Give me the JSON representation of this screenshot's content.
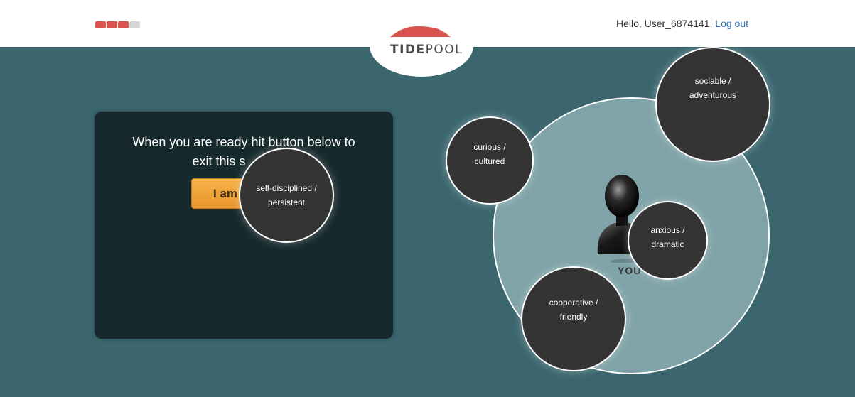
{
  "header": {
    "progress": {
      "segments": [
        {
          "color": "#d9534f"
        },
        {
          "color": "#d9534f"
        },
        {
          "color": "#d9534f"
        },
        {
          "color": "#d6d6d6"
        }
      ]
    },
    "greeting": "Hello, User_6874141,",
    "logout_label": "Log out",
    "logo_text_bold": "TIDE",
    "logo_text_rest": "POOL",
    "colors": {
      "accent": "#d9534f",
      "link": "#2d72b8"
    }
  },
  "panel": {
    "message_line1": "When you are ready hit button below to",
    "message_line2": "exit this s",
    "button_label": "I am"
  },
  "chart": {
    "center_label": "YOU",
    "traits": [
      {
        "line1": "self-disciplined /",
        "line2": "persistent"
      },
      {
        "line1": "curious /",
        "line2": "cultured"
      },
      {
        "line1": "sociable /",
        "line2": "adventurous"
      },
      {
        "line1": "anxious /",
        "line2": "dramatic"
      },
      {
        "line1": "cooperative /",
        "line2": "friendly"
      }
    ]
  }
}
